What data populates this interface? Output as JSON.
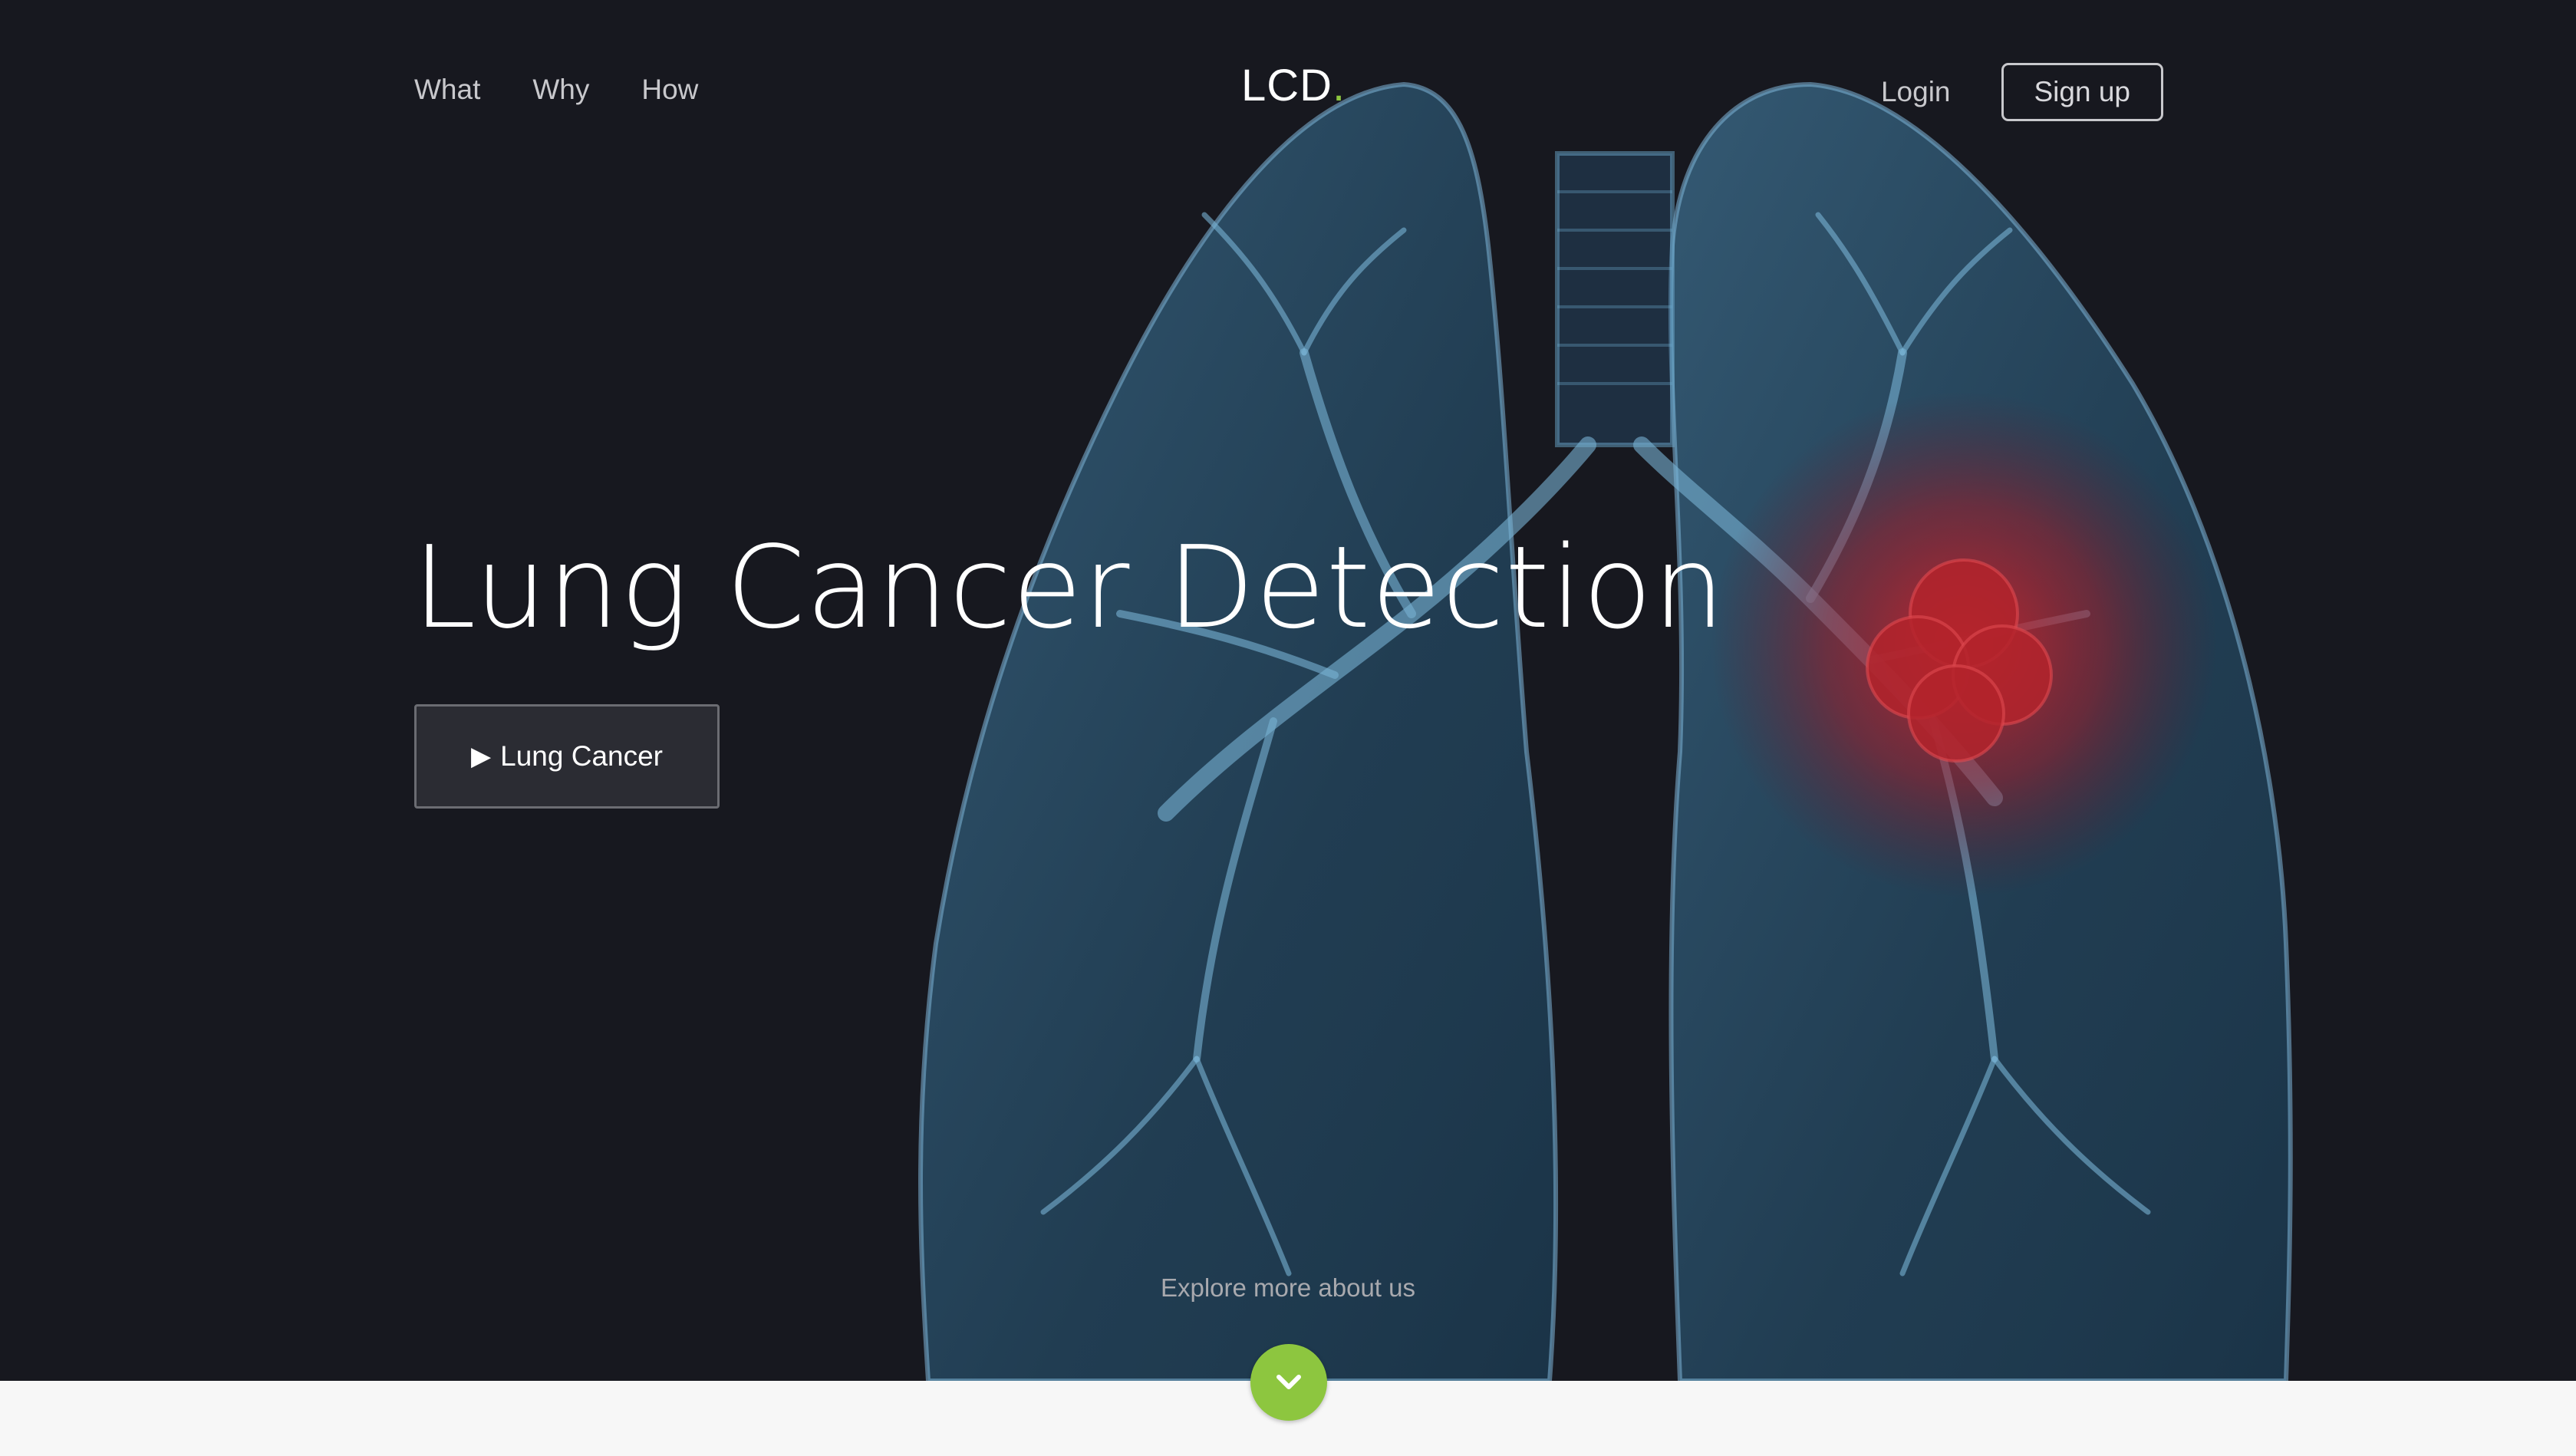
{
  "nav": {
    "links": [
      "What",
      "Why",
      "How"
    ],
    "logo_text": "LCD",
    "logo_dot": ".",
    "login_label": "Login",
    "signup_label": "Sign up"
  },
  "hero": {
    "title": "Lung Cancer Detection",
    "cta_label": "Lung Cancer",
    "cta_icon": "play-icon",
    "explore_text": "Explore more about us",
    "scroll_icon": "chevron-down-icon"
  },
  "colors": {
    "background": "#17181f",
    "accent": "#8dc63f",
    "lung": "#3a7fa8",
    "tumor": "#c0262b",
    "footer": "#f7f7f7"
  }
}
